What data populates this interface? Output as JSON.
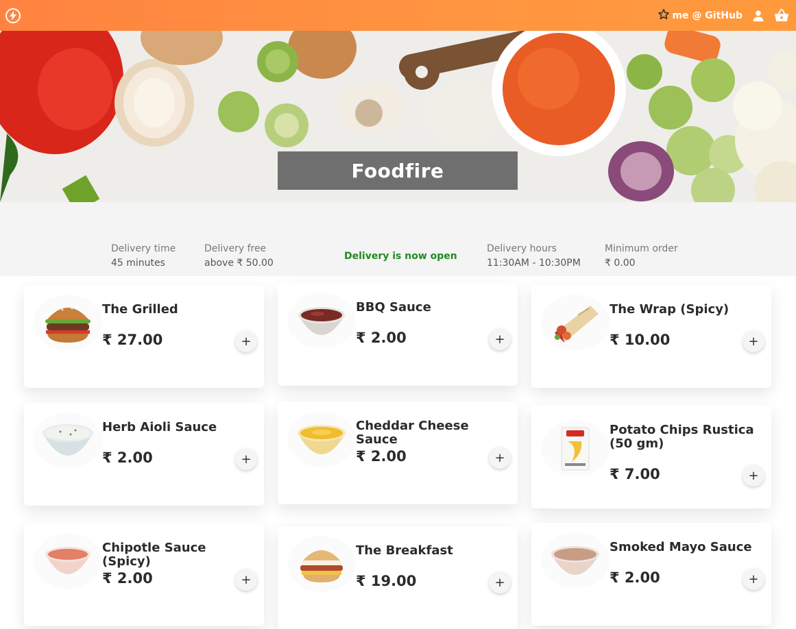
{
  "header": {
    "logo_icon": "lightning-bolt-icon",
    "github_link": "me @ GitHub",
    "star_icon": "star-outline-icon",
    "user_icon": "user-icon",
    "cart_icon": "shopping-basket-icon",
    "colors": {
      "gradient_start": "#ff8340",
      "gradient_end": "#ff9a3c"
    }
  },
  "hero": {
    "title": "Foodfire"
  },
  "info": {
    "delivery_time_label": "Delivery time",
    "delivery_time_value": "45 minutes",
    "delivery_free_label": "Delivery free",
    "delivery_free_value": "above ₹ 50.00",
    "status": "Delivery is now open",
    "delivery_hours_label": "Delivery hours",
    "delivery_hours_value": "11:30AM - 10:30PM",
    "min_order_label": "Minimum order",
    "min_order_value": "₹ 0.00",
    "status_color": "#1f8a22"
  },
  "menu": {
    "add_label": "+",
    "items": [
      {
        "name": "The Grilled",
        "price": "₹ 27.00",
        "icon": "burger"
      },
      {
        "name": "BBQ Sauce",
        "price": "₹ 2.00",
        "icon": "bbq-sauce-bowl"
      },
      {
        "name": "The Wrap (Spicy)",
        "price": "₹ 10.00",
        "icon": "wrap"
      },
      {
        "name": "Herb Aioli Sauce",
        "price": "₹ 2.00",
        "icon": "herb-sauce-bowl"
      },
      {
        "name": "Cheddar Cheese Sauce",
        "price": "₹ 2.00",
        "icon": "cheese-sauce-bowl"
      },
      {
        "name": "Potato Chips Rustica (50 gm)",
        "price": "₹ 7.00",
        "icon": "chips-bag"
      },
      {
        "name": "Chipotle Sauce (Spicy)",
        "price": "₹ 2.00",
        "icon": "chipotle-sauce-bowl"
      },
      {
        "name": "The Breakfast",
        "price": "₹ 19.00",
        "icon": "breakfast-sandwich"
      },
      {
        "name": "Smoked Mayo Sauce",
        "price": "₹ 2.00",
        "icon": "mayo-sauce-bowl"
      }
    ]
  }
}
